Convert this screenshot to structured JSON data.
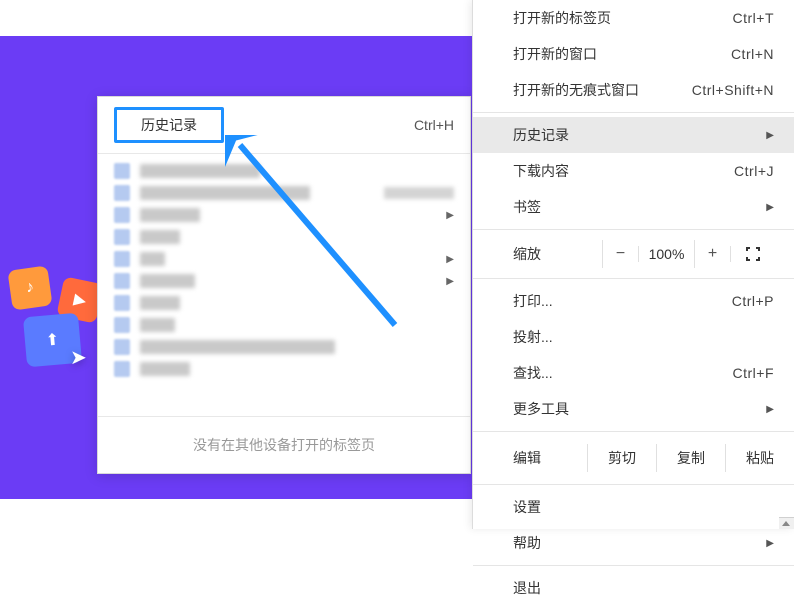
{
  "historyPanel": {
    "title": "历史记录",
    "shortcut": "Ctrl+H",
    "footer": "没有在其他设备打开的标签页"
  },
  "menu": {
    "newTab": {
      "label": "打开新的标签页",
      "shortcut": "Ctrl+T"
    },
    "newWindow": {
      "label": "打开新的窗口",
      "shortcut": "Ctrl+N"
    },
    "newIncognito": {
      "label": "打开新的无痕式窗口",
      "shortcut": "Ctrl+Shift+N"
    },
    "history": {
      "label": "历史记录"
    },
    "downloads": {
      "label": "下载内容",
      "shortcut": "Ctrl+J"
    },
    "bookmarks": {
      "label": "书签"
    },
    "zoom": {
      "label": "缩放",
      "minus": "−",
      "value": "100%",
      "plus": "+"
    },
    "print": {
      "label": "打印...",
      "shortcut": "Ctrl+P"
    },
    "cast": {
      "label": "投射..."
    },
    "find": {
      "label": "查找...",
      "shortcut": "Ctrl+F"
    },
    "moreTools": {
      "label": "更多工具"
    },
    "edit": {
      "label": "编辑",
      "cut": "剪切",
      "copy": "复制",
      "paste": "粘贴"
    },
    "settings": {
      "label": "设置"
    },
    "help": {
      "label": "帮助"
    },
    "exit": {
      "label": "退出"
    }
  }
}
